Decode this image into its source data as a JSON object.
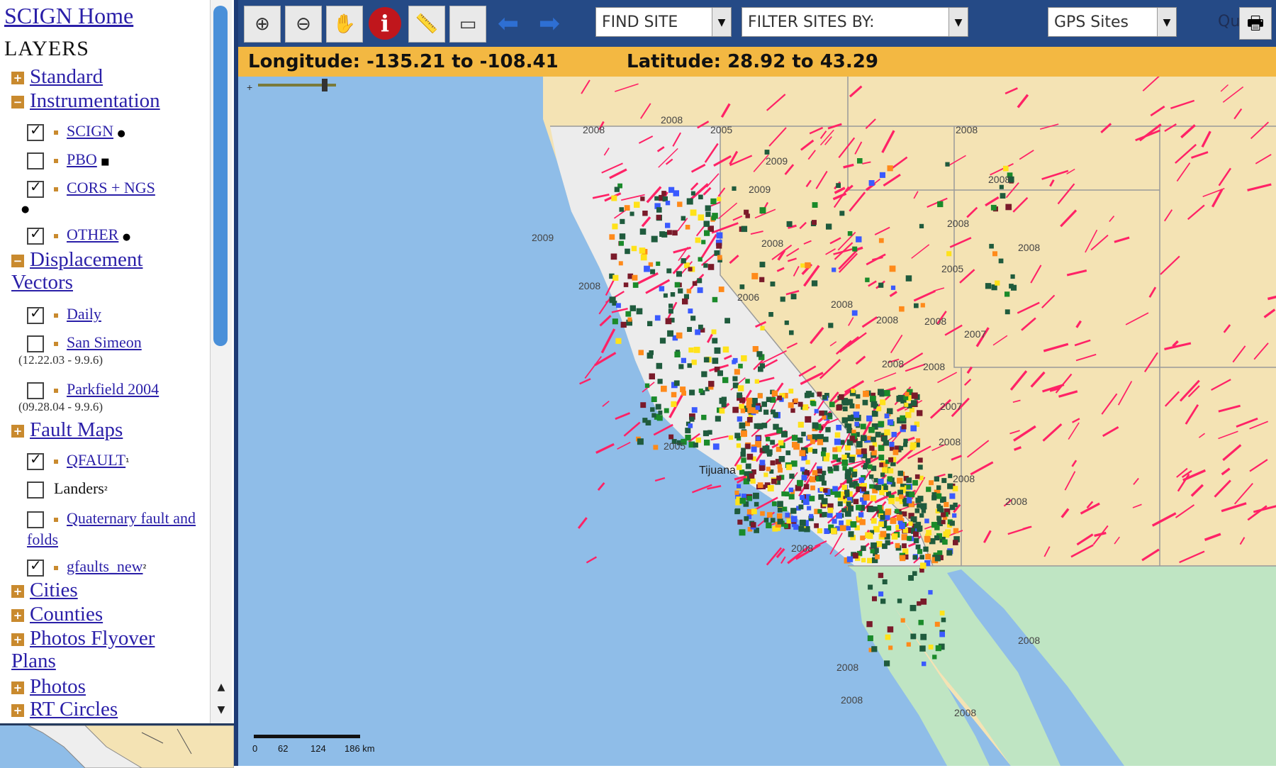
{
  "sidebar": {
    "home_link": "SCIGN Home",
    "layers_heading": "LAYERS",
    "groups": [
      {
        "label": "Standard",
        "toggle": "+"
      },
      {
        "label": "Instrumentation",
        "toggle": "−"
      },
      {
        "label": "Displacement Vectors",
        "toggle": "−"
      },
      {
        "label": "Fault Maps",
        "toggle": "+"
      },
      {
        "label": "Cities",
        "toggle": "+"
      },
      {
        "label": "Counties",
        "toggle": "+"
      },
      {
        "label": "Photos Flyover Plans",
        "toggle": "+"
      },
      {
        "label": "Photos",
        "toggle": "+"
      },
      {
        "label": "RT Circles",
        "toggle": "+"
      }
    ],
    "instrumentation_items": [
      {
        "label": "SCIGN",
        "checked": true
      },
      {
        "label": "PBO",
        "checked": false
      },
      {
        "label": "CORS + NGS",
        "checked": true
      },
      {
        "label": "OTHER",
        "checked": true
      }
    ],
    "vector_items": [
      {
        "label": "Daily",
        "checked": true,
        "range": ""
      },
      {
        "label": "San Simeon",
        "checked": false,
        "range": "(12.22.03 - 9.9.6)"
      },
      {
        "label": "Parkfield 2004",
        "checked": false,
        "range": "(09.28.04 - 9.9.6)"
      }
    ],
    "fault_items": [
      {
        "label": "QFAULT",
        "checked": true,
        "link": true
      },
      {
        "label": "Landers",
        "checked": false,
        "link": false
      },
      {
        "label": "Quaternary fault and folds",
        "checked": false,
        "link": true
      },
      {
        "label": "gfaults_new",
        "checked": true,
        "link": true
      }
    ]
  },
  "toolbar": {
    "tools": [
      {
        "name": "zoom-in",
        "icon": "zoom-in-icon"
      },
      {
        "name": "zoom-out",
        "icon": "zoom-out-icon"
      },
      {
        "name": "pan",
        "icon": "hand-icon"
      },
      {
        "name": "info",
        "icon": "info-icon",
        "glyph": "i"
      },
      {
        "name": "measure",
        "icon": "measure-icon"
      },
      {
        "name": "select",
        "icon": "select-rect-icon"
      },
      {
        "name": "back",
        "icon": "arrow-left-icon"
      },
      {
        "name": "forward",
        "icon": "arrow-right-icon"
      }
    ],
    "find_site": "FIND SITE",
    "filter_sites": "FILTER SITES BY:",
    "query_label": "Query:",
    "query_value": "GPS Sites"
  },
  "coords": {
    "longitude": "Longitude: -135.21 to -108.41",
    "latitude": "Latitude: 28.92 to 43.29"
  },
  "map": {
    "colors": {
      "ocean": "#8fbde8",
      "land": "#f4e3b4",
      "california": "#eeeeee",
      "mexico": "#bfe5c3",
      "faults": "#ff2266",
      "sites": "#1f5b3d"
    },
    "scale_ticks": [
      "0",
      "62",
      "124",
      "186 km"
    ],
    "site_labels": [
      "2008",
      "2008",
      "2005",
      "2009",
      "2008",
      "2008",
      "2009",
      "2009",
      "2008",
      "2008",
      "2006",
      "2008",
      "2008",
      "2005",
      "2008",
      "2008",
      "2008",
      "2007",
      "2008",
      "2007",
      "2008",
      "2005",
      "2008",
      "2008",
      "2008",
      "2008",
      "2008",
      "2008",
      "2008",
      "2008"
    ],
    "city_label": "Tijuana"
  }
}
